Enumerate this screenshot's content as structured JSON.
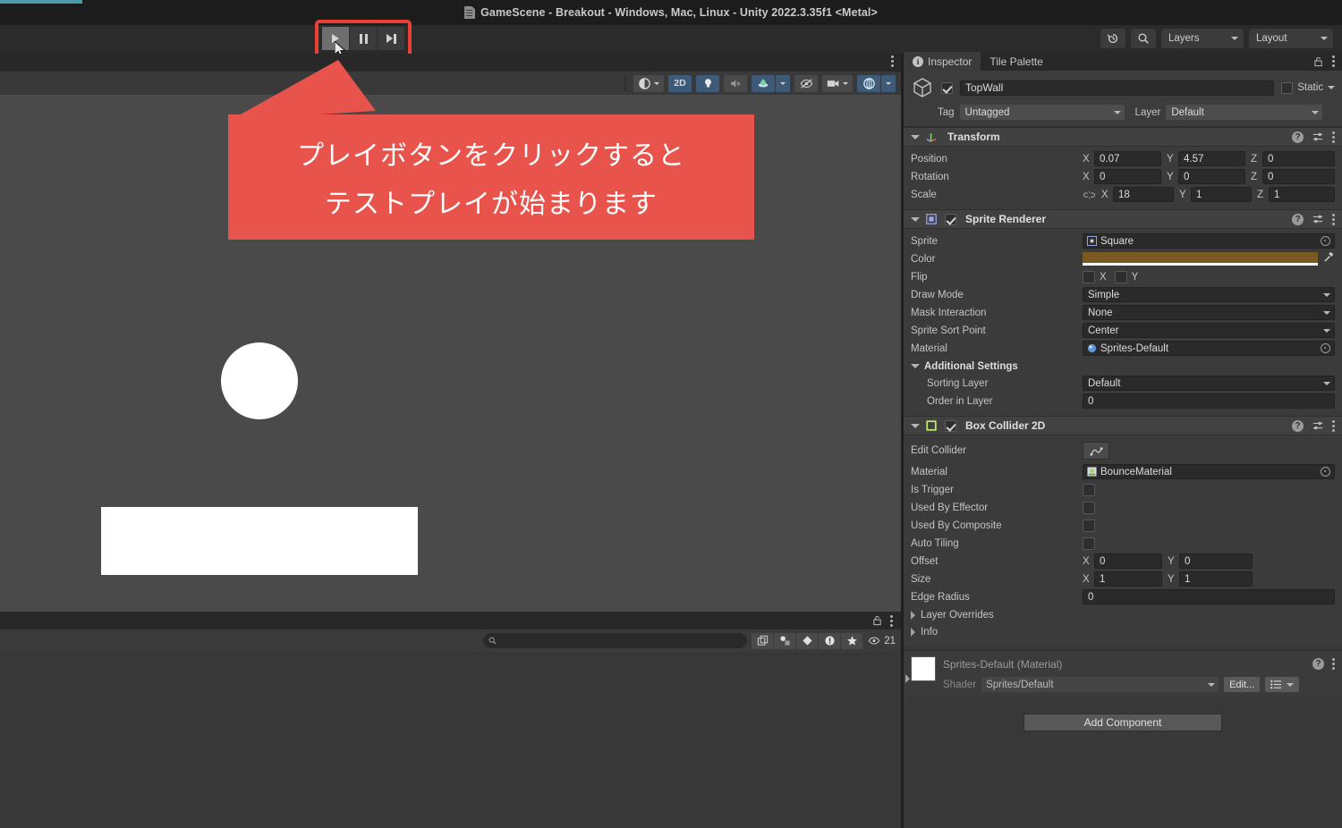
{
  "window": {
    "title": "GameScene - Breakout - Windows, Mac, Linux - Unity 2022.3.35f1 <Metal>",
    "doc_icon": "scene-file-icon"
  },
  "toolbar": {
    "play_button": "play-icon",
    "pause_button": "pause-icon",
    "step_button": "step-icon",
    "history_icon": "undo-history-icon",
    "search_icon": "search-icon",
    "layers_label": "Layers",
    "layout_label": "Layout"
  },
  "scene_view": {
    "toolbar": {
      "shading_label": "",
      "mode_2d_label": "2D",
      "light_icon": "lightbulb-icon",
      "audio_icon": "audio-mute-icon",
      "fx_icon": "effects-icon",
      "hidden_icon": "visibility-off-icon",
      "camera_icon": "scene-camera-icon",
      "gizmos_icon": "gizmos-icon"
    },
    "menu_icon": "kebab-menu-icon",
    "objects": {
      "ball": "ball-sprite",
      "paddle": "paddle-sprite"
    }
  },
  "project_panel": {
    "lock_icon": "lock-icon",
    "menu_icon": "kebab-menu-icon",
    "search_placeholder": "",
    "search_value": "",
    "filter_icons": [
      "save-search-icon",
      "filter-by-type-icon",
      "filter-by-label-icon",
      "warning-filter-icon",
      "favorites-icon"
    ],
    "visible_count": "21",
    "eye_icon": "eye-icon"
  },
  "inspector": {
    "tabs": [
      {
        "label": "Inspector",
        "icon": "info-icon",
        "selected": true
      },
      {
        "label": "Tile Palette",
        "icon": "",
        "selected": false
      }
    ],
    "lock_icon": "lock-icon",
    "menu_icon": "kebab-menu-icon",
    "object": {
      "icon": "gameobject-cube-icon",
      "enabled": true,
      "name": "TopWall",
      "static_label": "Static",
      "static_checked": false,
      "tag_label": "Tag",
      "tag_value": "Untagged",
      "layer_label": "Layer",
      "layer_value": "Default"
    },
    "transform": {
      "title": "Transform",
      "icon": "transform-axes-icon",
      "rows": [
        {
          "label": "Position",
          "x": "0.07",
          "y": "4.57",
          "z": "0"
        },
        {
          "label": "Rotation",
          "x": "0",
          "y": "0",
          "z": "0"
        },
        {
          "label": "Scale",
          "x": "18",
          "y": "1",
          "z": "1",
          "lock_icon": "broken-link-icon"
        }
      ],
      "axis_x": "X",
      "axis_y": "Y",
      "axis_z": "Z"
    },
    "sprite_renderer": {
      "title": "Sprite Renderer",
      "icon": "sprite-renderer-icon",
      "enabled": true,
      "sprite_label": "Sprite",
      "sprite_value": "Square",
      "color_label": "Color",
      "color_value": "#7a5a22",
      "color_alpha": "#ffffff",
      "eyedropper_icon": "eyedropper-icon",
      "flip_label": "Flip",
      "flip_x_label": "X",
      "flip_y_label": "Y",
      "draw_mode_label": "Draw Mode",
      "draw_mode_value": "Simple",
      "mask_interaction_label": "Mask Interaction",
      "mask_interaction_value": "None",
      "sprite_sort_point_label": "Sprite Sort Point",
      "sprite_sort_point_value": "Center",
      "material_label": "Material",
      "material_value": "Sprites-Default",
      "additional_settings_label": "Additional Settings",
      "sorting_layer_label": "Sorting Layer",
      "sorting_layer_value": "Default",
      "order_in_layer_label": "Order in Layer",
      "order_in_layer_value": "0"
    },
    "box_collider_2d": {
      "title": "Box Collider 2D",
      "icon": "box-collider-2d-icon",
      "enabled": true,
      "edit_collider_label": "Edit Collider",
      "edit_collider_icon": "edit-collider-icon",
      "material_label": "Material",
      "material_value": "BounceMaterial",
      "is_trigger_label": "Is Trigger",
      "used_by_effector_label": "Used By Effector",
      "used_by_composite_label": "Used By Composite",
      "auto_tiling_label": "Auto Tiling",
      "offset_label": "Offset",
      "offset_x": "0",
      "offset_y": "0",
      "size_label": "Size",
      "size_x": "1",
      "size_y": "1",
      "edge_radius_label": "Edge Radius",
      "edge_radius_value": "0",
      "layer_overrides_label": "Layer Overrides",
      "info_label": "Info"
    },
    "material_preview": {
      "title": "Sprites-Default (Material)",
      "shader_label": "Shader",
      "shader_value": "Sprites/Default",
      "edit_button": "Edit...",
      "preset_icon": "preset-icon"
    },
    "add_component_label": "Add Component"
  },
  "callout": {
    "line1": "プレイボタンをクリックすると",
    "line2": "テストプレイが始まります",
    "bg_color": "#e8544b",
    "highlight_color": "#ea3f35"
  }
}
